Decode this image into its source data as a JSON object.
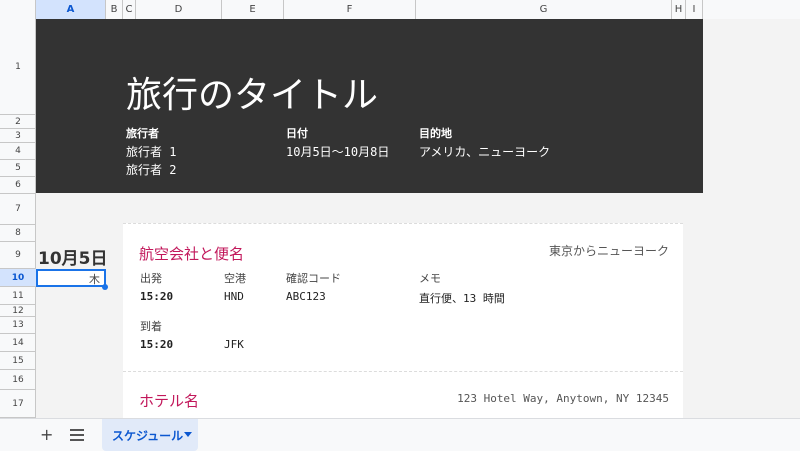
{
  "columns": [
    "A",
    "B",
    "C",
    "D",
    "E",
    "F",
    "G",
    "H",
    "I"
  ],
  "rows": [
    "1",
    "2",
    "3",
    "4",
    "5",
    "6",
    "7",
    "8",
    "9",
    "10",
    "11",
    "12",
    "13",
    "14",
    "15",
    "16",
    "17"
  ],
  "banner": {
    "title": "旅行のタイトル",
    "travelers_label": "旅行者",
    "travelers": [
      "旅行者 1",
      "旅行者 2"
    ],
    "dates_label": "日付",
    "dates": "10月5日～10月8日",
    "destination_label": "目的地",
    "destination": "アメリカ、ニューヨーク"
  },
  "day": {
    "date": "10月5日",
    "weekday": "木"
  },
  "flight": {
    "title": "航空会社と便名",
    "route": "東京からニューヨーク",
    "departure_label": "出発",
    "departure_time": "15:20",
    "airport_label": "空港",
    "departure_airport": "HND",
    "confirmation_label": "確認コード",
    "confirmation_code": "ABC123",
    "memo_label": "メモ",
    "memo": "直行便、13 時間",
    "arrival_label": "到着",
    "arrival_time": "15:20",
    "arrival_airport": "JFK"
  },
  "hotel": {
    "title": "ホテル名",
    "address": "123 Hotel Way, Anytown, NY 12345"
  },
  "bottom": {
    "add_sheet": "+",
    "sheet_tab": "スケジュール"
  },
  "colors": {
    "banner_bg": "#333333",
    "accent_pink": "#c2185b",
    "selection_blue": "#1a73e8"
  }
}
